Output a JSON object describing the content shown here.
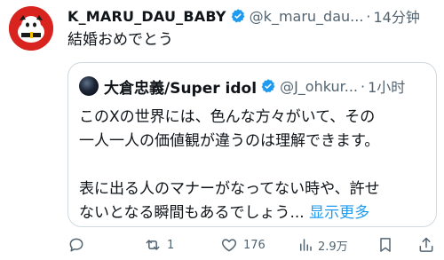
{
  "tweet": {
    "author_name": "K_MARU_DAU_BABY",
    "handle": "@k_maru_dau...",
    "separator": "·",
    "time": "14分钟",
    "text": "結婚おめでとう"
  },
  "quote": {
    "author_name": "大倉忠義/Super idol",
    "handle": "@J_ohkur...",
    "separator": "·",
    "time": "1小时",
    "paragraph1_line1": "このXの世界には、色んな方々がいて、その",
    "paragraph1_line2": "一人一人の価値観が違うのは理解できます。",
    "paragraph2_line1": "表に出る人のマナーがなってない時や、許せ",
    "paragraph2_line2": "ないとなる瞬間もあるでしょう... ",
    "show_more": "显示更多"
  },
  "actions": {
    "reply_count": "",
    "retweet_count": "1",
    "like_count": "176",
    "views_count": "2.9万"
  },
  "colors": {
    "verified_blue": "#1d9bf0",
    "muted_text": "#536471",
    "link": "#1d9bf0",
    "avatar_red": "#d8231f"
  },
  "icons": {
    "verified": "verified-badge-icon",
    "reply": "reply-icon",
    "retweet": "retweet-icon",
    "like": "heart-icon",
    "views": "views-icon",
    "bookmark": "bookmark-icon",
    "share": "share-icon"
  }
}
